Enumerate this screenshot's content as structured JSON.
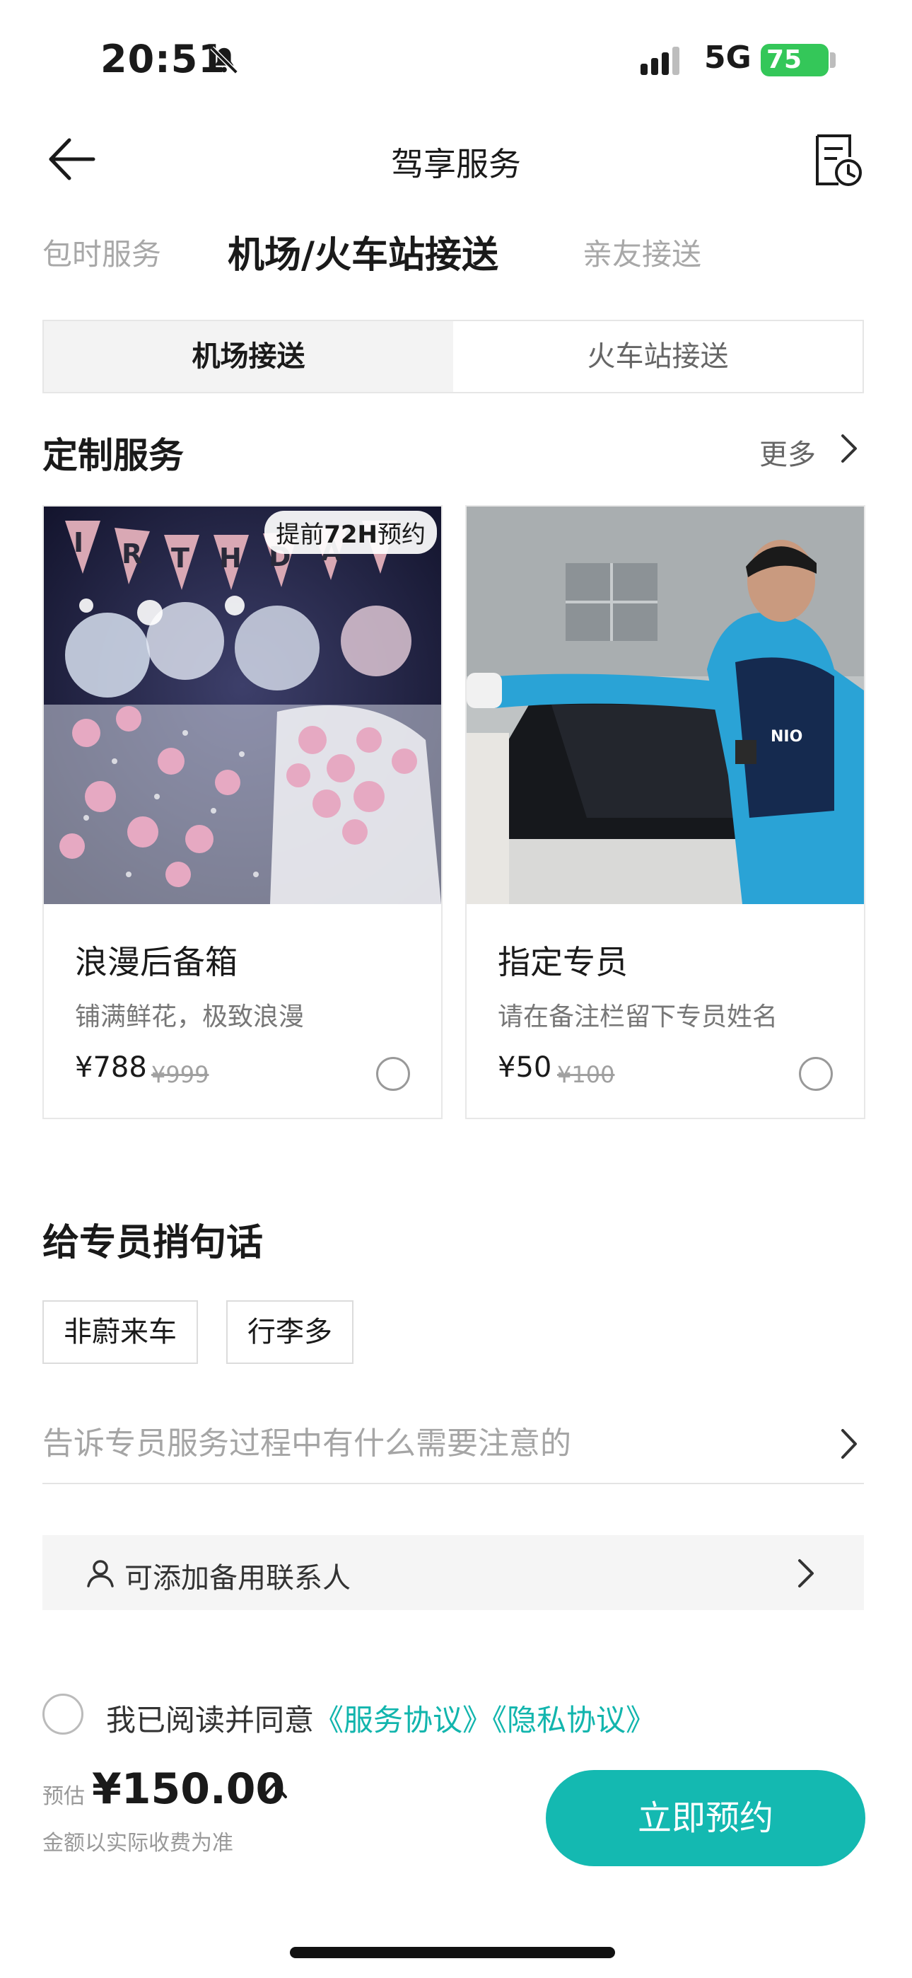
{
  "status_bar": {
    "time": "20:51",
    "network": "5G",
    "battery": "75"
  },
  "nav": {
    "title": "驾享服务"
  },
  "tabs": [
    {
      "label": "包时服务",
      "active": false
    },
    {
      "label": "机场/火车站接送",
      "active": true
    },
    {
      "label": "亲友接送",
      "active": false
    }
  ],
  "segment": [
    {
      "label": "机场接送",
      "active": true
    },
    {
      "label": "火车站接送",
      "active": false
    }
  ],
  "custom_section": {
    "title": "定制服务",
    "more": "更多"
  },
  "cards": [
    {
      "badge_prefix": "提前",
      "badge_bold": "72H",
      "badge_suffix": "预约",
      "name": "浪漫后备箱",
      "desc": "铺满鲜花，极致浪漫",
      "price": "¥788",
      "old_price": "¥999"
    },
    {
      "name": "指定专员",
      "desc": "请在备注栏留下专员姓名",
      "price": "¥50",
      "old_price": "¥100",
      "jacket_text": "NIO"
    }
  ],
  "message": {
    "title": "给专员捎句话",
    "chips": [
      "非蔚来车",
      "行李多"
    ],
    "placeholder": "告诉专员服务过程中有什么需要注意的"
  },
  "contact": {
    "label": "可添加备用联系人"
  },
  "agreement": {
    "text": "我已阅读并同意",
    "link1": "《服务协议》",
    "link2": "《隐私协议》"
  },
  "bottom": {
    "est_label": "预估",
    "price": "¥150.00",
    "note": "金额以实际收费为准",
    "button": "立即预约"
  },
  "colors": {
    "accent": "#14b9b1",
    "battery": "#34c759"
  }
}
